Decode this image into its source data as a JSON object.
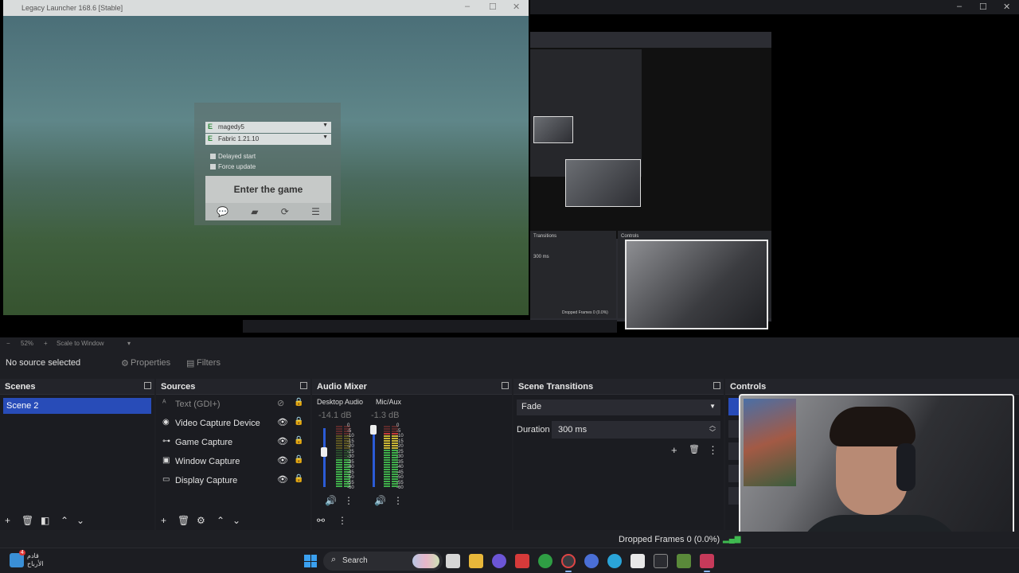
{
  "launcher": {
    "window_title": "Legacy Launcher 168.6 [Stable]",
    "account": "magedy5",
    "version": "Fabric 1.21.10",
    "badge": "E",
    "delayed_start": "Delayed start",
    "force_update": "Force update",
    "enter_button": "Enter the game"
  },
  "nested": {
    "transitions_label": "Transitions",
    "controls_label": "Controls",
    "duration": "300 ms",
    "dropped": "Dropped Frames 0 (0.0%)"
  },
  "zoom": {
    "minus": "−",
    "level": "52%",
    "plus": "+",
    "scale_mode": "Scale to Window"
  },
  "context": {
    "no_source": "No source selected",
    "properties": "Properties",
    "filters": "Filters"
  },
  "scenes": {
    "title": "Scenes",
    "items": [
      "Scene 2"
    ]
  },
  "sources": {
    "title": "Sources",
    "items": [
      {
        "label": "Text (GDI+)",
        "icon": "text-icon"
      },
      {
        "label": "Video Capture Device",
        "icon": "camera-icon"
      },
      {
        "label": "Game Capture",
        "icon": "gamepad-icon"
      },
      {
        "label": "Window Capture",
        "icon": "window-icon"
      },
      {
        "label": "Display Capture",
        "icon": "monitor-icon"
      }
    ]
  },
  "mixer": {
    "title": "Audio Mixer",
    "channels": [
      {
        "name": "Desktop Audio",
        "db": "-14.1 dB",
        "level": 0.48
      },
      {
        "name": "Mic/Aux",
        "db": "-1.3 dB",
        "level": 0.9
      }
    ],
    "ticks": [
      "0",
      "-5",
      "-10",
      "-15",
      "-20",
      "-25",
      "-30",
      "-35",
      "-40",
      "-45",
      "-50",
      "-55",
      "-60"
    ]
  },
  "transitions": {
    "title": "Scene Transitions",
    "selected": "Fade",
    "duration_label": "Duration",
    "duration_value": "300 ms"
  },
  "controls": {
    "title": "Controls"
  },
  "status": {
    "dropped": "Dropped Frames 0 (0.0%)"
  },
  "taskbar": {
    "weather_badge": "4",
    "weather_line1": "قادم",
    "weather_line2": "الأرباح",
    "search": "Search"
  },
  "colors": {
    "accent": "#284cb8",
    "panel": "#1b1c21",
    "header": "#23242a"
  }
}
